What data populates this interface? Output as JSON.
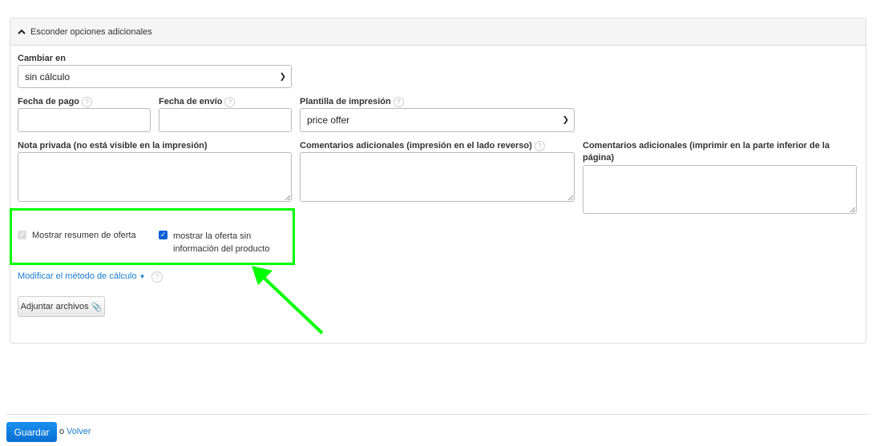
{
  "panel": {
    "toggle_label": "Esconder opciones adicionales"
  },
  "form": {
    "cambiar_en": {
      "label": "Cambiar en",
      "value": "sin cálculo"
    },
    "fecha_pago": {
      "label": "Fecha de pago",
      "value": ""
    },
    "fecha_envio": {
      "label": "Fecha de envío",
      "value": ""
    },
    "plantilla": {
      "label": "Plantilla de impresión",
      "value": "price offer"
    },
    "nota_privada": {
      "label": "Nota privada (no está visible en la impresión)",
      "value": ""
    },
    "comentarios_reverso": {
      "label": "Comentarios adicionales (impresión en el lado reverso)",
      "value": ""
    },
    "comentarios_inferior": {
      "label": "Comentarios adicionales (imprimir en la parte inferior de la página)",
      "value": ""
    },
    "mostrar_resumen": {
      "label": "Mostrar resumen de oferta",
      "checked": true,
      "disabled": true
    },
    "mostrar_sin_info": {
      "label": "mostrar la oferta sin información del producto",
      "checked": true
    },
    "metodo_link": "Modificar el método de cálculo",
    "adjuntar": "Adjuntar archivos",
    "help": "?"
  },
  "footer": {
    "save": "Guardar",
    "or": "o",
    "back": "Volver"
  },
  "colors": {
    "highlight": "#00ff00",
    "primary": "#0a7ee0",
    "link": "#1a7bd0"
  }
}
